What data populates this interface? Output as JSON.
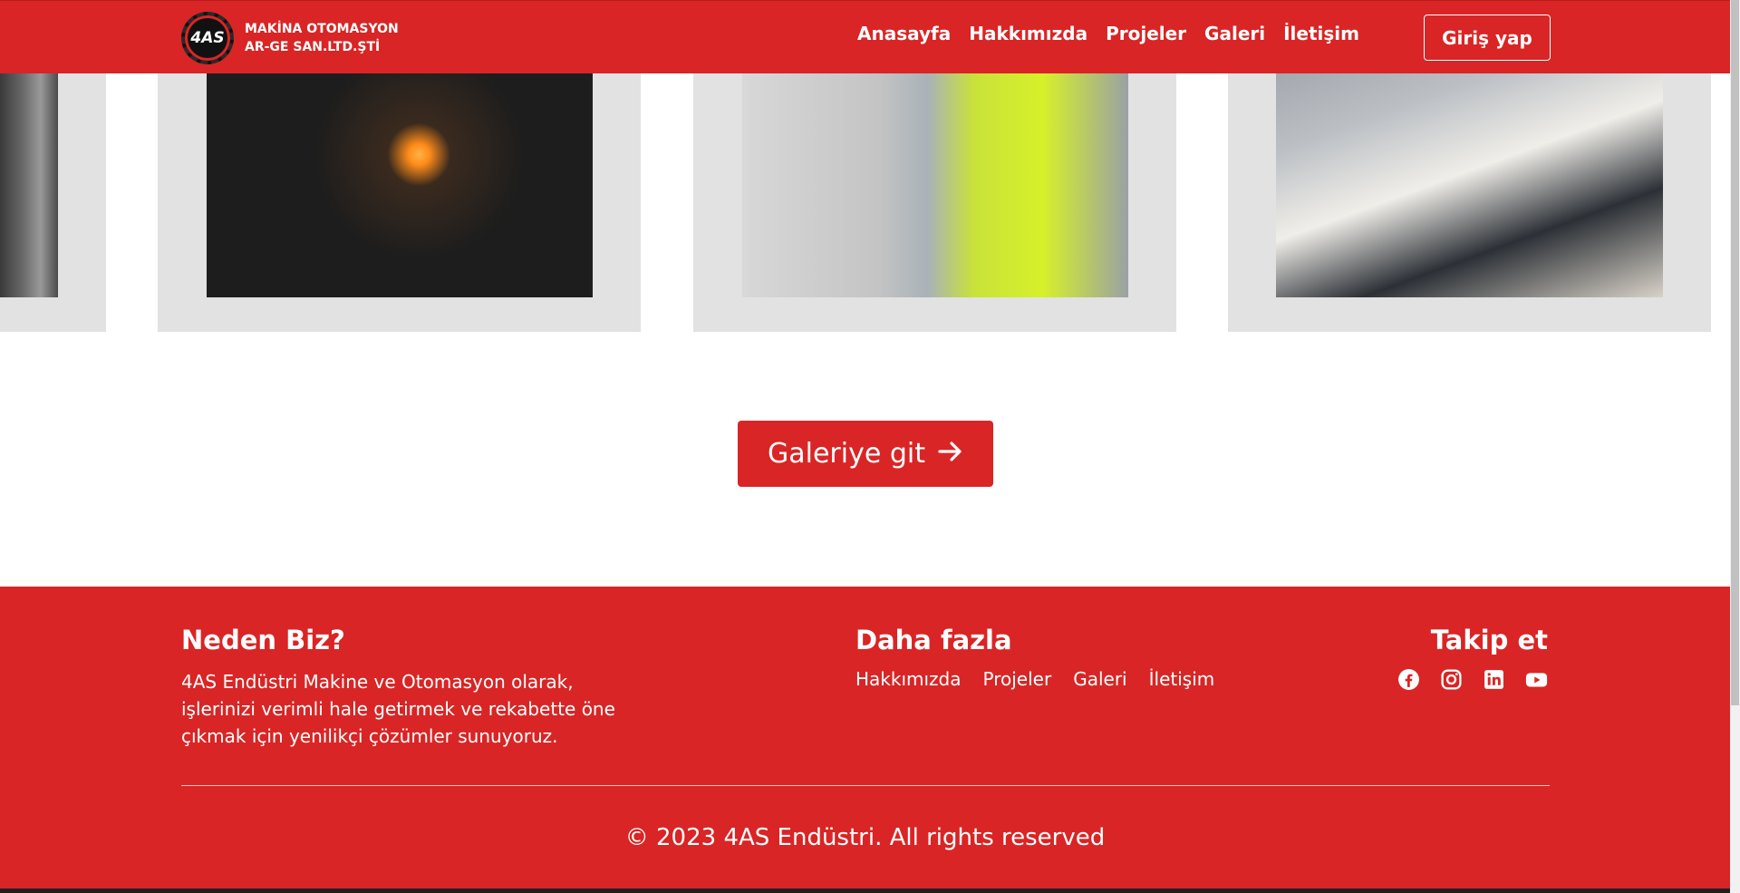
{
  "navbar": {
    "logo_text": "4AS",
    "brand_line1": "MAKİNA OTOMASYON",
    "brand_line2": "AR-GE SAN.LTD.ŞTİ",
    "links": [
      "Anasayfa",
      "Hakkımızda",
      "Projeler",
      "Galeri",
      "İletişim"
    ],
    "login_label": "Giriş yap"
  },
  "gallery": {
    "images": [
      "welder-photo",
      "electrician-tablet-photo",
      "businessman-laptop-phone-photo"
    ]
  },
  "cta": {
    "label": "Galeriye git",
    "icon": "arrow-right-icon"
  },
  "footer": {
    "why_title": "Neden Biz?",
    "why_text": "4AS Endüstri Makine ve Otomasyon olarak, işlerinizi verimli hale getirmek ve rekabette öne çıkmak için yenilikçi çözümler sunuyoruz.",
    "more_title": "Daha fazla",
    "more_links": [
      "Hakkımızda",
      "Projeler",
      "Galeri",
      "İletişim"
    ],
    "follow_title": "Takip et",
    "socials": [
      "facebook-icon",
      "instagram-icon",
      "linkedin-icon",
      "youtube-icon"
    ],
    "copyright": "© 2023 4AS Endüstri. All rights reserved"
  },
  "colors": {
    "brand_red": "#d92525",
    "card_gray": "#e2e2e2",
    "white": "#ffffff"
  }
}
